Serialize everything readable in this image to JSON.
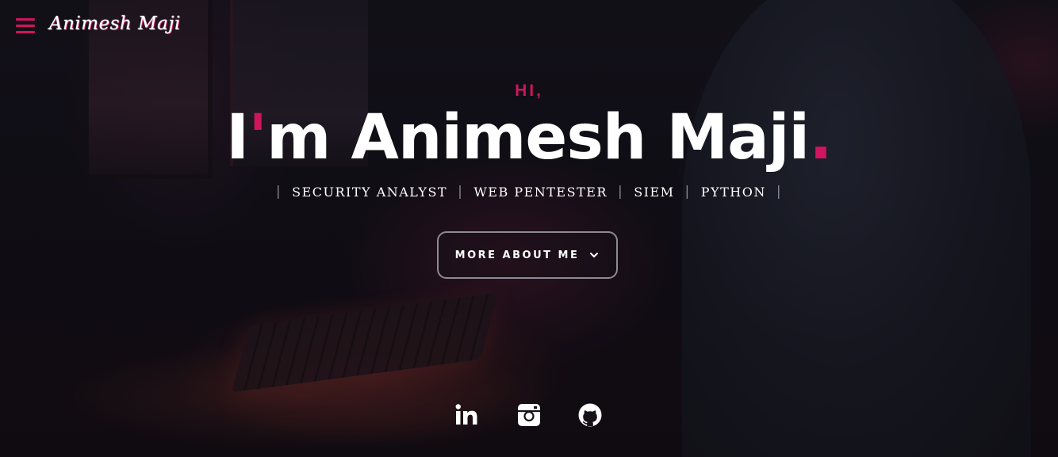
{
  "header": {
    "menu_icon": "hamburger-menu-icon",
    "logo_text": "Animesh Maji"
  },
  "hero": {
    "greeting": "HI,",
    "name_apostrophe": "'",
    "name_before": "I",
    "name_after": "m Animesh Maji",
    "name_dot": ".",
    "roles": [
      "SECURITY ANALYST",
      "WEB PENTESTER",
      "SIEM",
      "PYTHON"
    ],
    "separator": "|",
    "cta_label": "MORE ABOUT ME",
    "cta_icon": "chevron-down-icon"
  },
  "socials": [
    {
      "icon": "linkedin-icon"
    },
    {
      "icon": "instagram-icon"
    },
    {
      "icon": "github-icon"
    }
  ],
  "colors": {
    "accent": "#d0145e",
    "text": "#ffffff",
    "button_border": "#8c8a95",
    "background": "#0d0f16"
  }
}
